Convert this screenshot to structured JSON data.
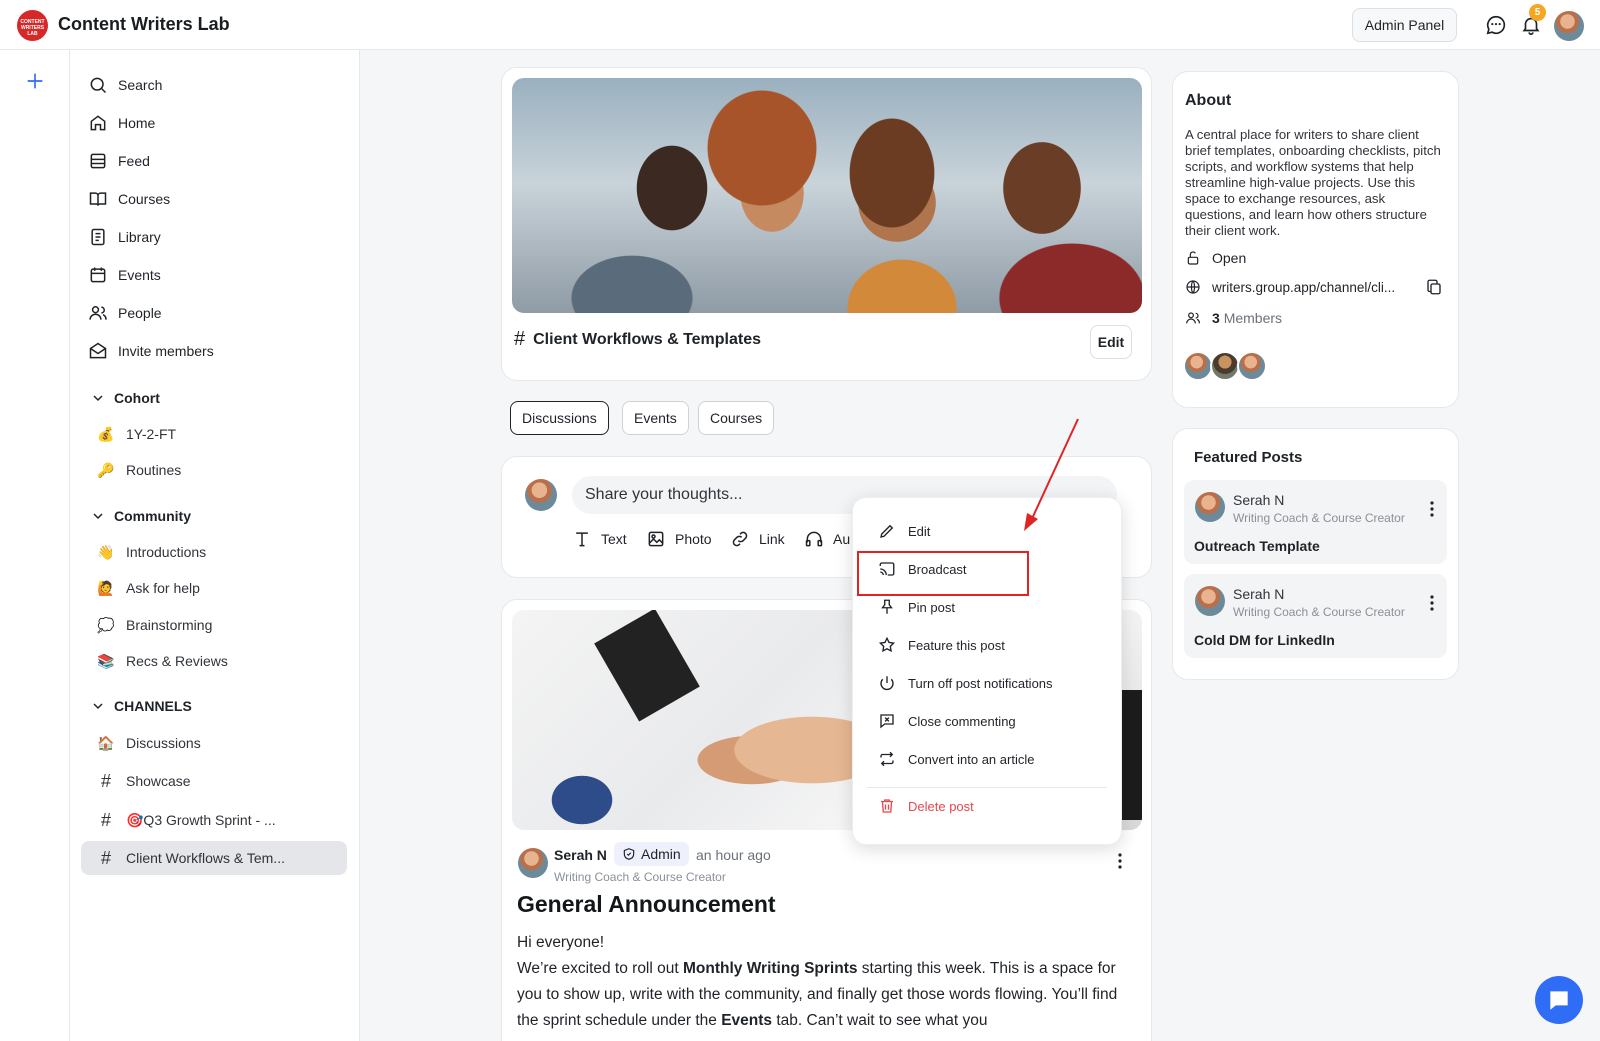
{
  "app": {
    "title": "Content Writers Lab",
    "logo_text": "CONTENT WRITERS LAB"
  },
  "topbar": {
    "admin_panel": "Admin Panel",
    "notification_count": "5"
  },
  "sidebar": {
    "nav": [
      {
        "label": "Search",
        "icon": "search-icon"
      },
      {
        "label": "Home",
        "icon": "home-icon"
      },
      {
        "label": "Feed",
        "icon": "feed-icon"
      },
      {
        "label": "Courses",
        "icon": "book-icon"
      },
      {
        "label": "Library",
        "icon": "library-icon"
      },
      {
        "label": "Events",
        "icon": "calendar-icon"
      },
      {
        "label": "People",
        "icon": "people-icon"
      },
      {
        "label": "Invite members",
        "icon": "envelope-icon"
      }
    ],
    "cohort": {
      "label": "Cohort",
      "items": [
        {
          "emoji": "💰",
          "label": "1Y-2-FT"
        },
        {
          "emoji": "🔑",
          "label": "Routines"
        }
      ]
    },
    "community": {
      "label": "Community",
      "items": [
        {
          "emoji": "👋",
          "label": "Introductions"
        },
        {
          "emoji": "🙋",
          "label": "Ask for help"
        },
        {
          "emoji": "💭",
          "label": "Brainstorming"
        },
        {
          "emoji": "📚",
          "label": "Recs & Reviews"
        }
      ]
    },
    "channels": {
      "label": "CHANNELS",
      "items": [
        {
          "prefix": "🏠",
          "label": "Discussions"
        },
        {
          "prefix": "#",
          "label": "Showcase"
        },
        {
          "prefix": "#",
          "label": "🎯Q3 Growth Sprint - ..."
        },
        {
          "prefix": "#",
          "label": "Client Workflows & Tem..."
        }
      ]
    }
  },
  "channel": {
    "title": "Client Workflows & Templates",
    "edit_label": "Edit"
  },
  "tabs": [
    "Discussions",
    "Events",
    "Courses"
  ],
  "composer": {
    "placeholder": "Share your thoughts...",
    "tools": [
      {
        "label": "Text",
        "icon": "text-icon"
      },
      {
        "label": "Photo",
        "icon": "photo-icon"
      },
      {
        "label": "Link",
        "icon": "link-icon"
      },
      {
        "label": "Au",
        "icon": "headphones-icon"
      }
    ]
  },
  "post": {
    "author": "Serah N",
    "badge": "Admin",
    "time": "an hour ago",
    "role": "Writing Coach & Course Creator",
    "title": "General Announcement",
    "greeting": "Hi everyone!",
    "p1_a": "We’re excited to roll out ",
    "p1_b": "Monthly Writing Sprints",
    "p1_c": " starting this week. This is a space for you to show up, write with the community, and finally get those words flowing. You’ll find the sprint schedule under the ",
    "p1_d": "Events",
    "p1_e": " tab. Can’t wait to see what you"
  },
  "menu": {
    "items": [
      {
        "label": "Edit",
        "icon": "pencil-icon"
      },
      {
        "label": "Broadcast",
        "icon": "cast-icon"
      },
      {
        "label": "Pin post",
        "icon": "pin-icon"
      },
      {
        "label": "Feature this post",
        "icon": "star-icon"
      },
      {
        "label": "Turn off post notifications",
        "icon": "power-icon"
      },
      {
        "label": "Close commenting",
        "icon": "comment-off-icon"
      },
      {
        "label": "Convert into an article",
        "icon": "convert-icon"
      }
    ],
    "delete_label": "Delete post"
  },
  "about": {
    "title": "About",
    "description": "A central place for writers to share client brief templates, onboarding checklists, pitch scripts, and workflow systems that help streamline high-value projects. Use this space to exchange resources, ask questions, and learn how others structure their client work.",
    "visibility": "Open",
    "url": "writers.group.app/channel/cli...",
    "member_count": "3",
    "members_label": "Members"
  },
  "featured": {
    "title": "Featured Posts",
    "items": [
      {
        "author": "Serah N",
        "role": "Writing Coach & Course Creator",
        "post": "Outreach Template"
      },
      {
        "author": "Serah N",
        "role": "Writing Coach & Course Creator",
        "post": "Cold DM for LinkedIn"
      }
    ]
  },
  "colors": {
    "accent": "#2f6df6",
    "danger": "#e5484d",
    "annotation": "#e02424",
    "badge": "#f5a623"
  }
}
